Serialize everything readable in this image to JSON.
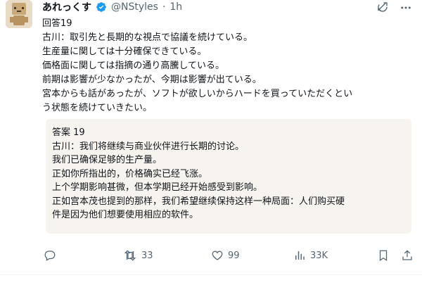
{
  "post": {
    "author": {
      "display_name": "あれっくす",
      "handle": "@NStyles",
      "separator": "·",
      "time": "1h"
    },
    "lines": [
      "回答19",
      "古川：取引先と長期的な視点で協議を続けている。",
      "生産量に関しては十分確保できている。",
      "価格面に関しては指摘の通り高騰している。",
      "前期は影響が少なかったが、今期は影響が出ている。",
      "宮本からも話があったが、ソフトが欲しいからハードを買っていただくとい",
      "う状態を続けていきたい。"
    ],
    "translation": [
      "答案 19",
      "古川：我们将继续与商业伙伴进行长期的讨论。",
      "我们已确保足够的生产量。",
      "正如你所指出的，价格确实已经飞涨。",
      "上个学期影响甚微，但本学期已经开始感受到影响。",
      "正如宫本茂也提到的那样，我们希望继续保持这样一种局面：人们购买硬",
      "件是因为他们想要使用相应的软件。"
    ],
    "actions": {
      "retweets": "33",
      "likes": "99",
      "views": "33K"
    }
  },
  "icons": {
    "header_right": [
      "grok-icon",
      "more-icon"
    ],
    "action_bar": [
      "reply-icon",
      "retweet-icon",
      "like-icon",
      "views-icon",
      "bookmark-icon",
      "share-icon"
    ]
  },
  "colors": {
    "verified": "#1d9bf0",
    "muted": "#536471",
    "quote_background": "#f7f3ef"
  }
}
